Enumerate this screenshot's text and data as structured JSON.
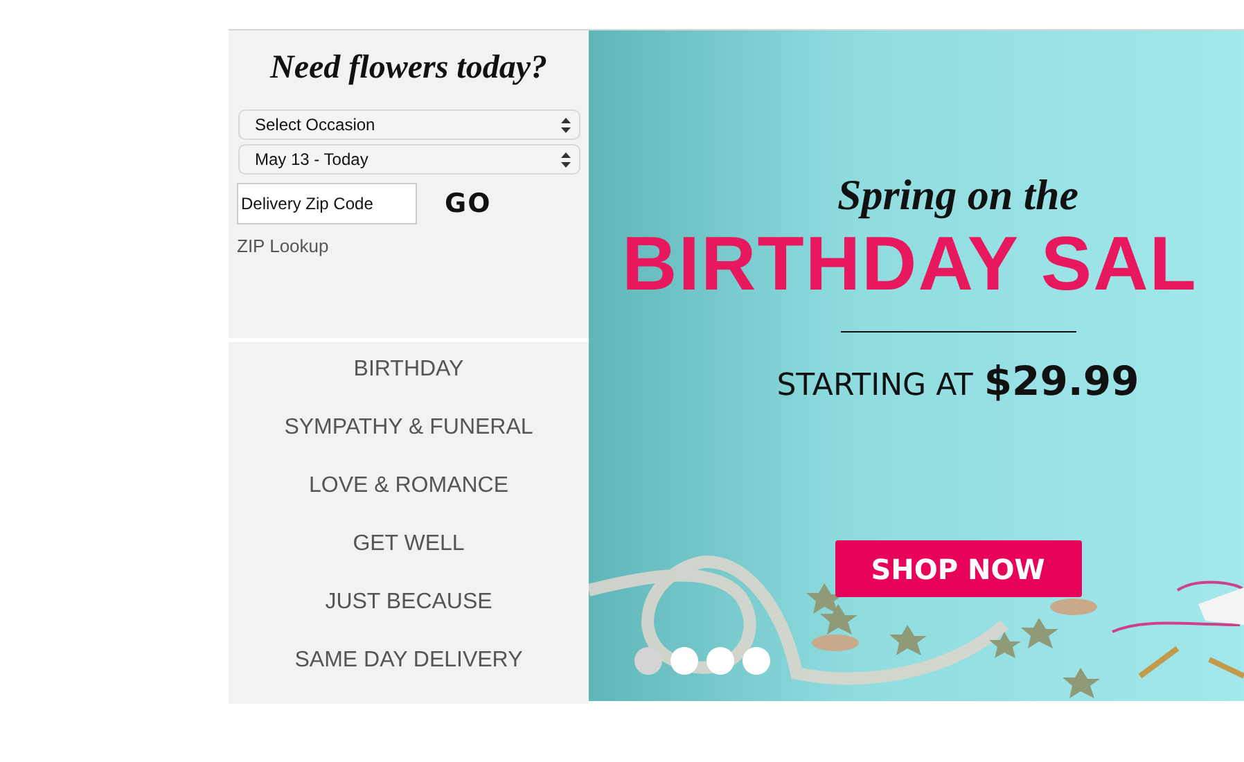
{
  "finder": {
    "heading": "Need flowers today?",
    "occasion_select": {
      "value": "Select Occasion"
    },
    "date_select": {
      "value": "May 13 - Today"
    },
    "zip_field": {
      "placeholder": "Delivery Zip Code"
    },
    "go_button": "GO",
    "zip_lookup": "ZIP Lookup"
  },
  "categories": [
    {
      "label": "BIRTHDAY"
    },
    {
      "label": "SYMPATHY & FUNERAL"
    },
    {
      "label": "LOVE & ROMANCE"
    },
    {
      "label": "GET WELL"
    },
    {
      "label": "JUST BECAUSE"
    },
    {
      "label": "SAME DAY DELIVERY"
    }
  ],
  "banner": {
    "kicker": "Spring on the",
    "headline": "BIRTHDAY SAL",
    "price_prefix": "STARTING AT",
    "price": "$29.99",
    "cta": "SHOP NOW",
    "dots": [
      {
        "selected": true
      },
      {
        "selected": false
      },
      {
        "selected": false
      },
      {
        "selected": false
      }
    ]
  }
}
